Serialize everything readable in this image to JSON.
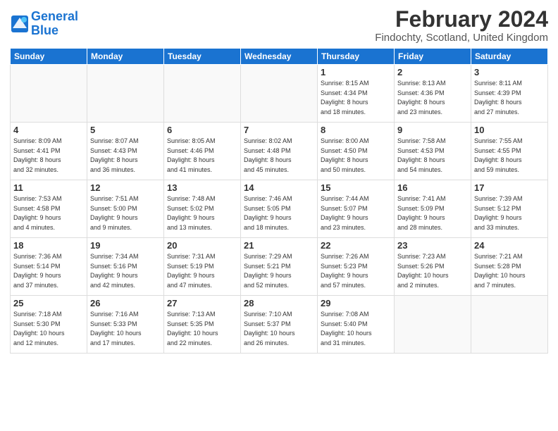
{
  "header": {
    "logo_line1": "General",
    "logo_line2": "Blue",
    "month_title": "February 2024",
    "location": "Findochty, Scotland, United Kingdom"
  },
  "weekdays": [
    "Sunday",
    "Monday",
    "Tuesday",
    "Wednesday",
    "Thursday",
    "Friday",
    "Saturday"
  ],
  "weeks": [
    [
      {
        "day": "",
        "detail": ""
      },
      {
        "day": "",
        "detail": ""
      },
      {
        "day": "",
        "detail": ""
      },
      {
        "day": "",
        "detail": ""
      },
      {
        "day": "1",
        "detail": "Sunrise: 8:15 AM\nSunset: 4:34 PM\nDaylight: 8 hours\nand 18 minutes."
      },
      {
        "day": "2",
        "detail": "Sunrise: 8:13 AM\nSunset: 4:36 PM\nDaylight: 8 hours\nand 23 minutes."
      },
      {
        "day": "3",
        "detail": "Sunrise: 8:11 AM\nSunset: 4:39 PM\nDaylight: 8 hours\nand 27 minutes."
      }
    ],
    [
      {
        "day": "4",
        "detail": "Sunrise: 8:09 AM\nSunset: 4:41 PM\nDaylight: 8 hours\nand 32 minutes."
      },
      {
        "day": "5",
        "detail": "Sunrise: 8:07 AM\nSunset: 4:43 PM\nDaylight: 8 hours\nand 36 minutes."
      },
      {
        "day": "6",
        "detail": "Sunrise: 8:05 AM\nSunset: 4:46 PM\nDaylight: 8 hours\nand 41 minutes."
      },
      {
        "day": "7",
        "detail": "Sunrise: 8:02 AM\nSunset: 4:48 PM\nDaylight: 8 hours\nand 45 minutes."
      },
      {
        "day": "8",
        "detail": "Sunrise: 8:00 AM\nSunset: 4:50 PM\nDaylight: 8 hours\nand 50 minutes."
      },
      {
        "day": "9",
        "detail": "Sunrise: 7:58 AM\nSunset: 4:53 PM\nDaylight: 8 hours\nand 54 minutes."
      },
      {
        "day": "10",
        "detail": "Sunrise: 7:55 AM\nSunset: 4:55 PM\nDaylight: 8 hours\nand 59 minutes."
      }
    ],
    [
      {
        "day": "11",
        "detail": "Sunrise: 7:53 AM\nSunset: 4:58 PM\nDaylight: 9 hours\nand 4 minutes."
      },
      {
        "day": "12",
        "detail": "Sunrise: 7:51 AM\nSunset: 5:00 PM\nDaylight: 9 hours\nand 9 minutes."
      },
      {
        "day": "13",
        "detail": "Sunrise: 7:48 AM\nSunset: 5:02 PM\nDaylight: 9 hours\nand 13 minutes."
      },
      {
        "day": "14",
        "detail": "Sunrise: 7:46 AM\nSunset: 5:05 PM\nDaylight: 9 hours\nand 18 minutes."
      },
      {
        "day": "15",
        "detail": "Sunrise: 7:44 AM\nSunset: 5:07 PM\nDaylight: 9 hours\nand 23 minutes."
      },
      {
        "day": "16",
        "detail": "Sunrise: 7:41 AM\nSunset: 5:09 PM\nDaylight: 9 hours\nand 28 minutes."
      },
      {
        "day": "17",
        "detail": "Sunrise: 7:39 AM\nSunset: 5:12 PM\nDaylight: 9 hours\nand 33 minutes."
      }
    ],
    [
      {
        "day": "18",
        "detail": "Sunrise: 7:36 AM\nSunset: 5:14 PM\nDaylight: 9 hours\nand 37 minutes."
      },
      {
        "day": "19",
        "detail": "Sunrise: 7:34 AM\nSunset: 5:16 PM\nDaylight: 9 hours\nand 42 minutes."
      },
      {
        "day": "20",
        "detail": "Sunrise: 7:31 AM\nSunset: 5:19 PM\nDaylight: 9 hours\nand 47 minutes."
      },
      {
        "day": "21",
        "detail": "Sunrise: 7:29 AM\nSunset: 5:21 PM\nDaylight: 9 hours\nand 52 minutes."
      },
      {
        "day": "22",
        "detail": "Sunrise: 7:26 AM\nSunset: 5:23 PM\nDaylight: 9 hours\nand 57 minutes."
      },
      {
        "day": "23",
        "detail": "Sunrise: 7:23 AM\nSunset: 5:26 PM\nDaylight: 10 hours\nand 2 minutes."
      },
      {
        "day": "24",
        "detail": "Sunrise: 7:21 AM\nSunset: 5:28 PM\nDaylight: 10 hours\nand 7 minutes."
      }
    ],
    [
      {
        "day": "25",
        "detail": "Sunrise: 7:18 AM\nSunset: 5:30 PM\nDaylight: 10 hours\nand 12 minutes."
      },
      {
        "day": "26",
        "detail": "Sunrise: 7:16 AM\nSunset: 5:33 PM\nDaylight: 10 hours\nand 17 minutes."
      },
      {
        "day": "27",
        "detail": "Sunrise: 7:13 AM\nSunset: 5:35 PM\nDaylight: 10 hours\nand 22 minutes."
      },
      {
        "day": "28",
        "detail": "Sunrise: 7:10 AM\nSunset: 5:37 PM\nDaylight: 10 hours\nand 26 minutes."
      },
      {
        "day": "29",
        "detail": "Sunrise: 7:08 AM\nSunset: 5:40 PM\nDaylight: 10 hours\nand 31 minutes."
      },
      {
        "day": "",
        "detail": ""
      },
      {
        "day": "",
        "detail": ""
      }
    ]
  ]
}
